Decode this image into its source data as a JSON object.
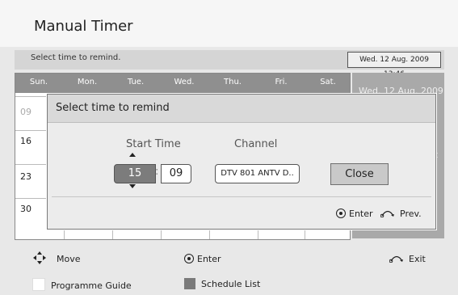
{
  "header": {
    "title": "Manual Timer"
  },
  "subbar": {
    "instruction": "Select time to remind.",
    "datetime": "Wed. 12 Aug. 2009 13:46"
  },
  "calendar": {
    "days": [
      "Sun.",
      "Mon.",
      "Tue.",
      "Wed.",
      "Thu.",
      "Fri.",
      "Sat."
    ],
    "rows": [
      "09",
      "16",
      "23",
      "30"
    ]
  },
  "sidepanel": {
    "line1": "Wed. 12 Aug. 2009",
    "line2": "t"
  },
  "modal": {
    "title": "Select time to remind",
    "start_time_label": "Start Time",
    "channel_label": "Channel",
    "hour": "15",
    "minute": "09",
    "colon": ":",
    "channel_value": "DTV 801 ANTV D..",
    "close_label": "Close",
    "enter_label": "Enter",
    "prev_label": "Prev."
  },
  "footer": {
    "move_label": "Move",
    "enter_label": "Enter",
    "exit_label": "Exit",
    "programme_guide_label": "Programme Guide",
    "schedule_list_label": "Schedule List"
  }
}
